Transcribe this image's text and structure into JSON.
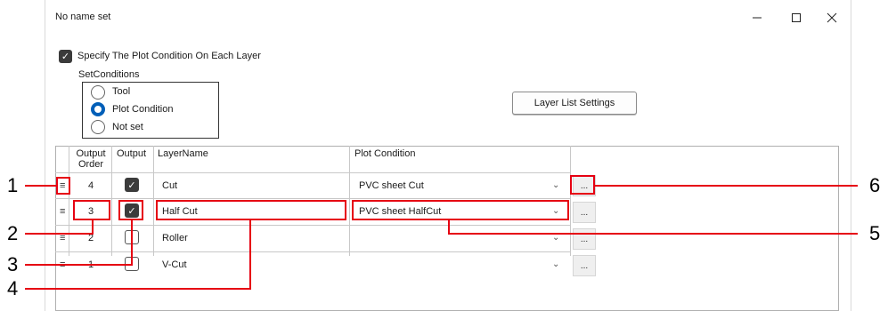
{
  "window": {
    "title": "No name set",
    "minimize_icon": "minimize-icon",
    "maximize_icon": "maximize-icon",
    "close_icon": "close-icon"
  },
  "specify_checkbox": {
    "label": "Specify The Plot Condition On Each Layer",
    "checked": true
  },
  "set_conditions": {
    "label": "SetConditions",
    "options": [
      {
        "label": "Tool",
        "selected": false
      },
      {
        "label": "Plot Condition",
        "selected": true
      },
      {
        "label": "Not set",
        "selected": false
      }
    ]
  },
  "layer_list_settings_button": "Layer List Settings",
  "grid": {
    "headers": {
      "output_order_1": "Output",
      "output_order_2": "Order",
      "output": "Output",
      "layer_name": "LayerName",
      "plot_condition": "Plot Condition"
    },
    "rows": [
      {
        "order": "4",
        "output": true,
        "layer": "Cut",
        "condition": "PVC sheet Cut",
        "more": "..."
      },
      {
        "order": "3",
        "output": true,
        "layer": "Half Cut",
        "condition": "PVC sheet HalfCut",
        "more": "..."
      },
      {
        "order": "2",
        "output": false,
        "layer": "Roller",
        "condition": "",
        "more": "..."
      },
      {
        "order": "1",
        "output": false,
        "layer": "V-Cut",
        "condition": "",
        "more": "..."
      }
    ]
  },
  "callouts": [
    "1",
    "2",
    "3",
    "4",
    "5",
    "6"
  ],
  "colors": {
    "callout": "#e60012",
    "radio_selected": "#005fb8",
    "checkbox_checked": "#3b3b3b"
  }
}
